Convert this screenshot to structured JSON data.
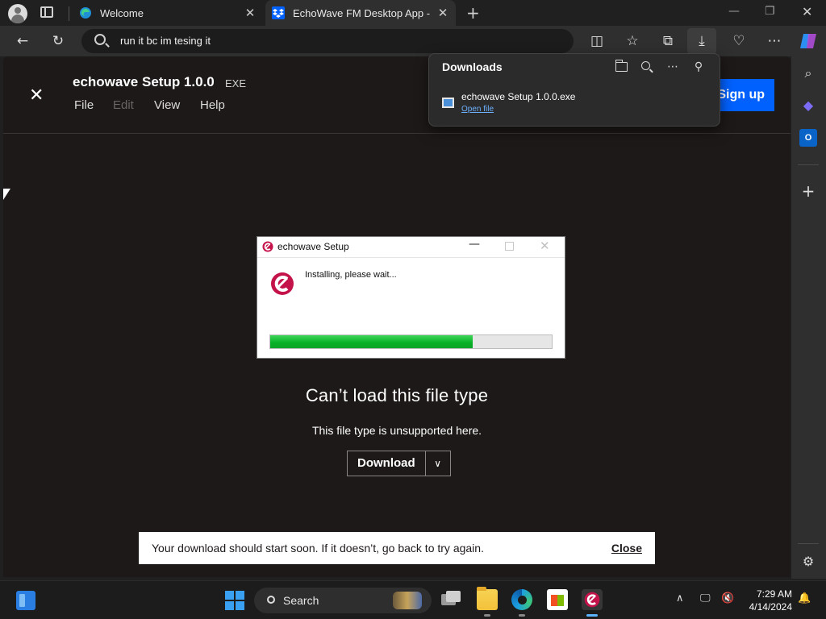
{
  "browser": {
    "tabs": [
      {
        "title": "Welcome",
        "active": false
      },
      {
        "title": "EchoWave FM Desktop App - Dr",
        "active": true
      }
    ],
    "address_bar": {
      "value": "run it bc im tesing it"
    },
    "colors": {
      "chrome": "#202020",
      "toolbar": "#2f2f2f",
      "accent": "#0061fe"
    }
  },
  "downloads_panel": {
    "title": "Downloads",
    "items": [
      {
        "file_name": "echowave Setup 1.0.0.exe",
        "action": "Open file"
      }
    ]
  },
  "preview": {
    "file_title": "echowave Setup 1.0.0",
    "file_ext": "EXE",
    "menu": {
      "file": "File",
      "edit": "Edit",
      "view": "View",
      "help": "Help"
    },
    "signup_label": "Sign up",
    "cant_load_title": "Can’t load this file type",
    "unsupported_text": "This file type is unsupported here.",
    "download_label": "Download",
    "snackbar": {
      "message": "Your download should start soon. If it doesn’t, go back to try again.",
      "close_label": "Close"
    }
  },
  "installer": {
    "window_title": "echowave Setup",
    "message": "Installing, please wait...",
    "progress_percent": 72,
    "progress_color": "#06b025"
  },
  "taskbar": {
    "search_label": "Search",
    "time": "7:29 AM",
    "date": "4/14/2024"
  }
}
